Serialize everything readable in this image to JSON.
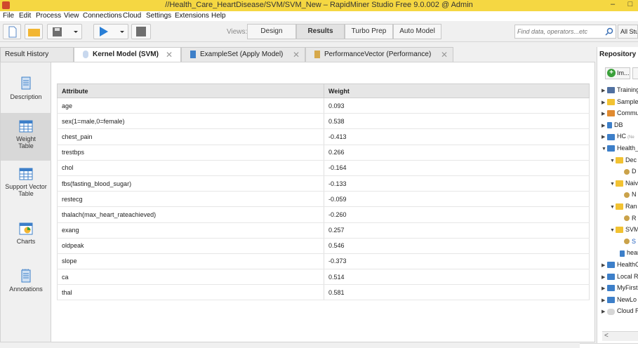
{
  "window": {
    "title": "//Health_Care_HeartDisease/SVM/SVM_New – RapidMiner Studio Free 9.0.002 @ Admin",
    "minimize_glyph": "–",
    "restore_glyph": "□"
  },
  "menu": [
    "File",
    "Edit",
    "Process",
    "View",
    "Connections",
    "Cloud",
    "Settings",
    "Extensions",
    "Help"
  ],
  "toolbar": {
    "views_label": "Views:",
    "views": [
      "Design",
      "Results",
      "Turbo Prep",
      "Auto Model"
    ],
    "active_view": "Results",
    "search_placeholder": "Find data, operators...etc",
    "account_label": "All Stu"
  },
  "tabs": [
    {
      "label": "Result History"
    },
    {
      "label": "Kernel Model (SVM)",
      "close": "✕"
    },
    {
      "label": "ExampleSet (Apply Model)",
      "close": "✕"
    },
    {
      "label": "PerformanceVector (Performance)",
      "close": "✕"
    }
  ],
  "sidebar": [
    {
      "label": "Description",
      "icon": "description-icon"
    },
    {
      "label": "Weight Table",
      "icon": "weight-table-icon",
      "active": true
    },
    {
      "label": "Support Vector Table",
      "icon": "support-vector-table-icon"
    },
    {
      "label": "Charts",
      "icon": "charts-icon"
    },
    {
      "label": "Annotations",
      "icon": "annotations-icon"
    }
  ],
  "table": {
    "headers": [
      "Attribute",
      "Weight"
    ],
    "rows": [
      [
        "age",
        "0.093"
      ],
      [
        "sex(1=male,0=female)",
        "0.538"
      ],
      [
        "chest_pain",
        "-0.413"
      ],
      [
        "trestbps",
        "0.266"
      ],
      [
        "chol",
        "-0.164"
      ],
      [
        "fbs(fasting_blood_sugar)",
        "-0.133"
      ],
      [
        "restecg",
        "-0.059"
      ],
      [
        "thalach(max_heart_rateachieved)",
        "-0.260"
      ],
      [
        "exang",
        "0.257"
      ],
      [
        "oldpeak",
        "0.546"
      ],
      [
        "slope",
        "-0.373"
      ],
      [
        "ca",
        "0.514"
      ],
      [
        "thal",
        "0.581"
      ]
    ]
  },
  "repository": {
    "title": "Repository",
    "import_label": "Im...",
    "items": [
      {
        "label": "Training",
        "icon": "training-icon",
        "arrow": "▶"
      },
      {
        "label": "Samples",
        "icon": "folder-icon",
        "arrow": "▶"
      },
      {
        "label": "Community",
        "icon": "community-icon",
        "arrow": "▶"
      },
      {
        "label": "DB",
        "icon": "database-icon",
        "arrow": "▶"
      },
      {
        "label": "HC",
        "icon": "monitor-icon",
        "arrow": "▶",
        "note": "(Ne"
      },
      {
        "label": "Health_",
        "icon": "monitor-icon",
        "arrow": "▼"
      },
      {
        "label": "Dec",
        "icon": "folder-icon",
        "arrow": "▼"
      },
      {
        "label": "D",
        "icon": "gear-icon",
        "arrow": ""
      },
      {
        "label": "Naiv",
        "icon": "folder-icon",
        "arrow": "▼"
      },
      {
        "label": "N",
        "icon": "gear-icon",
        "arrow": ""
      },
      {
        "label": "Ran",
        "icon": "folder-icon",
        "arrow": "▼"
      },
      {
        "label": "R",
        "icon": "gear-icon",
        "arrow": ""
      },
      {
        "label": "SVM",
        "icon": "folder-icon",
        "arrow": "▼"
      },
      {
        "label": "S",
        "icon": "gear-icon",
        "arrow": "",
        "selected": true
      },
      {
        "label": "hear",
        "icon": "table-icon",
        "arrow": ""
      },
      {
        "label": "HealthC",
        "icon": "monitor-icon",
        "arrow": "▶"
      },
      {
        "label": "Local R",
        "icon": "monitor-icon",
        "arrow": "▶"
      },
      {
        "label": "MyFirst",
        "icon": "monitor-icon",
        "arrow": "▶"
      },
      {
        "label": "NewLo",
        "icon": "monitor-icon",
        "arrow": "▶"
      },
      {
        "label": "Cloud R",
        "icon": "cloud-icon",
        "arrow": "▶"
      }
    ],
    "scroll_left_glyph": "<"
  },
  "colors": {
    "titlebar": "#f5d742",
    "accent": "#3d7fc9",
    "folder": "#f2c232"
  }
}
